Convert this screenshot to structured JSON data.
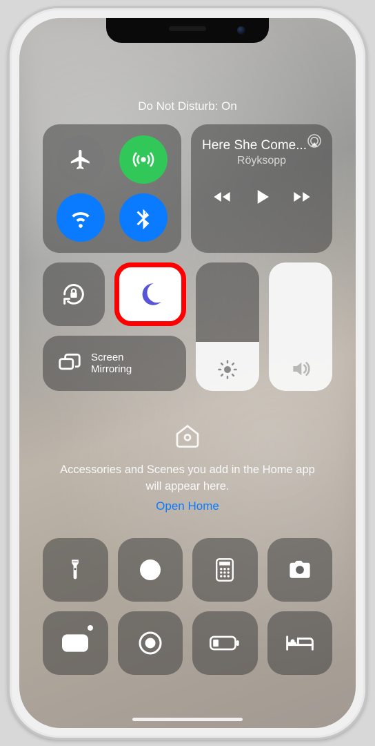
{
  "status": {
    "title": "Do Not Disturb: On"
  },
  "connectivity": {
    "airplane": false,
    "cellular": true,
    "wifi": true,
    "bluetooth": true
  },
  "media": {
    "track": "Here She Come...",
    "artist": "Röyksopp"
  },
  "controls": {
    "orientation_lock_label": "Orientation Lock",
    "dnd_label": "Do Not Disturb",
    "screen_mirroring_label": "Screen\nMirroring"
  },
  "sliders": {
    "brightness_percent": 38,
    "volume_percent": 100
  },
  "home": {
    "text": "Accessories and Scenes you add in the Home app will appear here.",
    "link": "Open Home"
  },
  "bottom": {
    "items": [
      "flashlight",
      "timer",
      "calculator",
      "camera",
      "voice-memos",
      "screen-record",
      "low-power",
      "sleep"
    ]
  },
  "highlight": {
    "target": "dnd"
  }
}
